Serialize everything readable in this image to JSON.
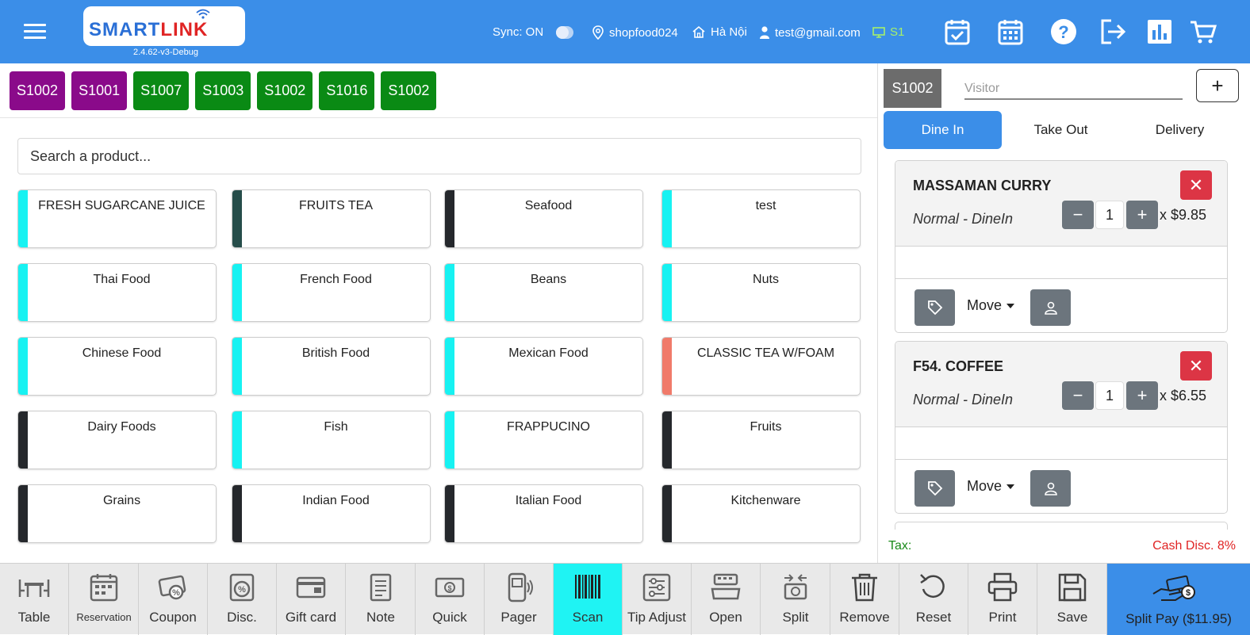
{
  "header": {
    "logo_smart": "SMART",
    "logo_link": "LINK",
    "version": "2.4.62-v3-Debug",
    "sync_label": "Sync: ON",
    "shop": "shopfood024",
    "city": "Hà Nội",
    "email": "test@gmail.com",
    "station": "S1",
    "icons": [
      "calendar-check-icon",
      "calendar-grid-icon",
      "help-icon",
      "logout-icon",
      "report-chart-icon",
      "cart-icon"
    ]
  },
  "tables": [
    {
      "label": "S1002",
      "color": "purple"
    },
    {
      "label": "S1001",
      "color": "purple"
    },
    {
      "label": "S1007",
      "color": "green"
    },
    {
      "label": "S1003",
      "color": "green"
    },
    {
      "label": "S1002",
      "color": "green"
    },
    {
      "label": "S1016",
      "color": "green"
    },
    {
      "label": "S1002",
      "color": "green"
    }
  ],
  "search": {
    "placeholder": "Search a product..."
  },
  "categories": [
    {
      "label": "FRESH SUGARCANE JUICE",
      "color": "#17f2f2"
    },
    {
      "label": "FRUITS TEA",
      "color": "#264d4a"
    },
    {
      "label": "Seafood",
      "color": "#25282c"
    },
    {
      "label": "test",
      "color": "#17f2f2"
    },
    {
      "label": "Thai Food",
      "color": "#17f2f2"
    },
    {
      "label": "French Food",
      "color": "#17f2f2"
    },
    {
      "label": "Beans",
      "color": "#17f2f2"
    },
    {
      "label": "Nuts",
      "color": "#17f2f2"
    },
    {
      "label": "Chinese Food",
      "color": "#17f2f2"
    },
    {
      "label": "British Food",
      "color": "#17f2f2"
    },
    {
      "label": "Mexican Food",
      "color": "#17f2f2"
    },
    {
      "label": "CLASSIC TEA W/FOAM",
      "color": "#f07a6a"
    },
    {
      "label": "Dairy Foods",
      "color": "#25282c"
    },
    {
      "label": "Fish",
      "color": "#17f2f2"
    },
    {
      "label": "FRAPPUCINO",
      "color": "#17f2f2"
    },
    {
      "label": "Fruits",
      "color": "#25282c"
    },
    {
      "label": "Grains",
      "color": "#25282c"
    },
    {
      "label": "Indian Food",
      "color": "#25282c"
    },
    {
      "label": "Italian Food",
      "color": "#25282c"
    },
    {
      "label": "Kitchenware",
      "color": "#25282c"
    }
  ],
  "order": {
    "table": "S1002",
    "visitor_placeholder": "Visitor",
    "add_label": "+",
    "modes": [
      "Dine In",
      "Take Out",
      "Delivery"
    ],
    "active_mode": "Dine In",
    "items": [
      {
        "name": "MASSAMAN CURRY",
        "variant": "Normal - DineIn",
        "qty": "1",
        "price": "x $9.85",
        "move_label": "Move"
      },
      {
        "name": "F54. COFFEE",
        "variant": "Normal - DineIn",
        "qty": "1",
        "price": "x $6.55",
        "move_label": "Move"
      }
    ],
    "tax_label": "Tax:",
    "cash_disc": "Cash Disc. 8%"
  },
  "toolbar": {
    "tools": [
      {
        "label": "Table",
        "icon": "table-chairs-icon"
      },
      {
        "label": "Reservation",
        "icon": "reservation-calendar-icon"
      },
      {
        "label": "Coupon",
        "icon": "coupon-icon"
      },
      {
        "label": "Disc.",
        "icon": "discount-icon"
      },
      {
        "label": "Gift card",
        "icon": "gift-card-icon"
      },
      {
        "label": "Note",
        "icon": "note-icon"
      },
      {
        "label": "Quick",
        "icon": "cash-icon"
      },
      {
        "label": "Pager",
        "icon": "pager-icon"
      },
      {
        "label": "Scan",
        "icon": "barcode-icon"
      },
      {
        "label": "Tip Adjust",
        "icon": "sliders-icon"
      },
      {
        "label": "Open",
        "icon": "cash-register-icon"
      },
      {
        "label": "Split",
        "icon": "split-money-icon"
      },
      {
        "label": "Remove",
        "icon": "trash-icon"
      },
      {
        "label": "Reset",
        "icon": "reset-icon"
      },
      {
        "label": "Print",
        "icon": "printer-icon"
      },
      {
        "label": "Save",
        "icon": "save-icon"
      }
    ],
    "active_tool": "Scan",
    "split_pay_label": "Split Pay ($11.95)"
  }
}
